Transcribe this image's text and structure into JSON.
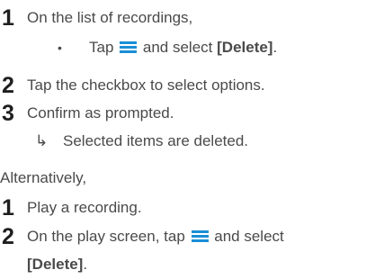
{
  "steps_a": [
    {
      "number": "1",
      "text": "On the list of recordings,",
      "sub_bullet": "•",
      "sub_pre": "Tap",
      "sub_mid": "and select",
      "sub_key": "[Delete]",
      "sub_post": "."
    },
    {
      "number": "2",
      "text": "Tap the checkbox to select options."
    },
    {
      "number": "3",
      "text": "Confirm as prompted.",
      "result_arrow": "↳",
      "result_text": "Selected items are deleted."
    }
  ],
  "alternative_label": "Alternatively,",
  "steps_b": [
    {
      "number": "1",
      "text": "Play a recording."
    },
    {
      "number": "2",
      "text_pre": "On the play screen, tap",
      "text_post": "and select",
      "text_line2_key": "[Delete]",
      "text_line2_post": "."
    }
  ],
  "icons": {
    "menu": "hamburger-menu-icon",
    "menu_color": "#1a8fd6"
  }
}
